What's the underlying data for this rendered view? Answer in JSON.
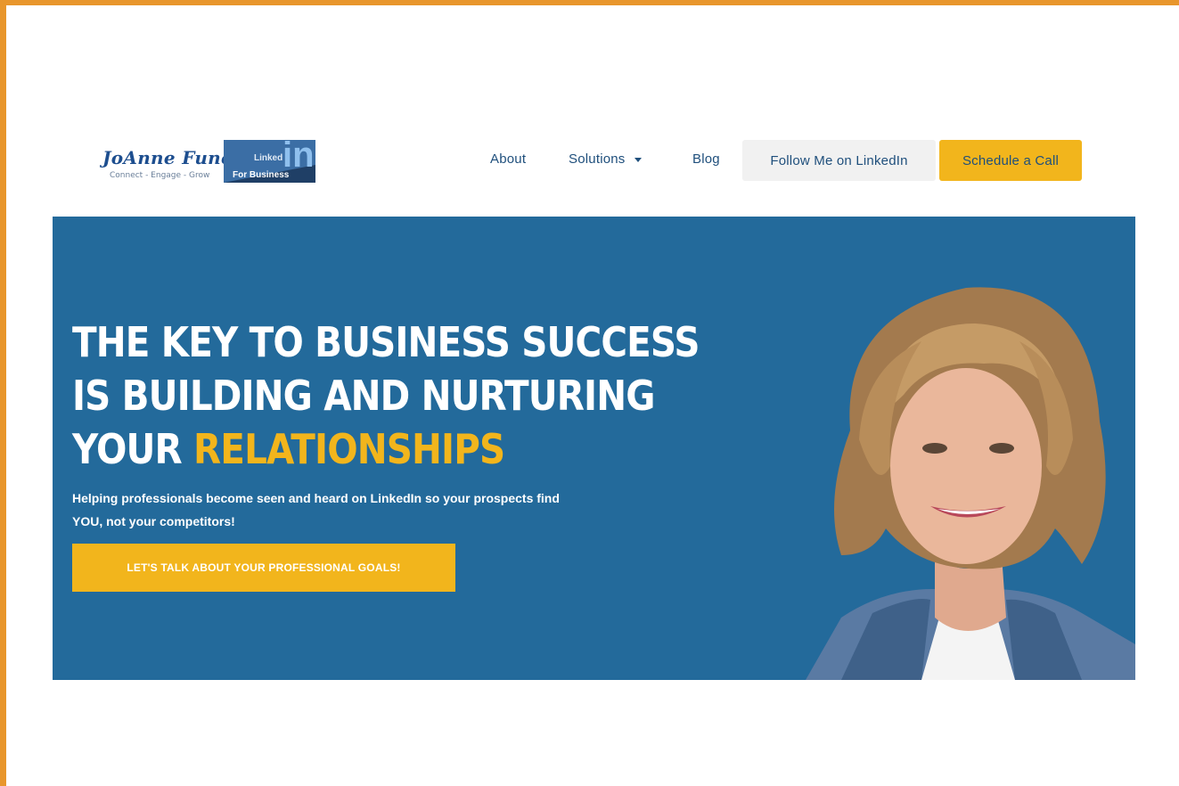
{
  "brand": {
    "name": "JoAnne Funch",
    "tagline": "Connect - Engage - Grow",
    "badge_linked": "Linked",
    "badge_in": "in",
    "badge_for": "For Business"
  },
  "nav": {
    "about": "About",
    "solutions": "Solutions",
    "blog": "Blog",
    "follow": "Follow Me on LinkedIn",
    "schedule": "Schedule a Call"
  },
  "hero": {
    "line1": "THE KEY TO BUSINESS SUCCESS",
    "line2": "IS BUILDING AND NURTURING",
    "line3_prefix": "YOUR ",
    "line3_highlight": "RELATIONSHIPS",
    "sub_part1": "Helping professionals become ",
    "sub_bold1": "seen",
    "sub_part2": " and ",
    "sub_bold2": "heard",
    "sub_part3": " on LinkedIn so your prospects find ",
    "sub_bold3": "YOU",
    "sub_part4": ", not your competitors!",
    "cta": "LET'S TALK ABOUT YOUR PROFESSIONAL GOALS!"
  },
  "colors": {
    "accent": "#f2b51c",
    "hero_bg": "#236a9b",
    "nav_text": "#1f4f7c",
    "frame": "#e8962c"
  }
}
